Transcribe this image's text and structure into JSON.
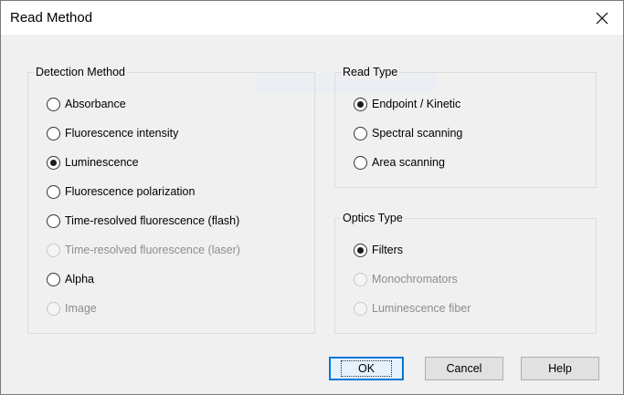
{
  "window": {
    "title": "Read Method",
    "close_icon": "close-icon"
  },
  "detection_method": {
    "label": "Detection Method",
    "options": [
      {
        "label": "Absorbance",
        "checked": false,
        "enabled": true
      },
      {
        "label": "Fluorescence intensity",
        "checked": false,
        "enabled": true
      },
      {
        "label": "Luminescence",
        "checked": true,
        "enabled": true
      },
      {
        "label": "Fluorescence polarization",
        "checked": false,
        "enabled": true
      },
      {
        "label": "Time-resolved fluorescence (flash)",
        "checked": false,
        "enabled": true
      },
      {
        "label": "Time-resolved fluorescence (laser)",
        "checked": false,
        "enabled": false
      },
      {
        "label": "Alpha",
        "checked": false,
        "enabled": true
      },
      {
        "label": "Image",
        "checked": false,
        "enabled": false
      }
    ]
  },
  "read_type": {
    "label": "Read Type",
    "options": [
      {
        "label": "Endpoint / Kinetic",
        "checked": true,
        "enabled": true
      },
      {
        "label": "Spectral scanning",
        "checked": false,
        "enabled": true
      },
      {
        "label": "Area scanning",
        "checked": false,
        "enabled": true
      }
    ]
  },
  "optics_type": {
    "label": "Optics Type",
    "options": [
      {
        "label": "Filters",
        "checked": true,
        "enabled": true
      },
      {
        "label": "Monochromators",
        "checked": false,
        "enabled": false
      },
      {
        "label": "Luminescence fiber",
        "checked": false,
        "enabled": false
      }
    ]
  },
  "buttons": {
    "ok": "OK",
    "cancel": "Cancel",
    "help": "Help"
  },
  "colors": {
    "accent": "#0078d7",
    "dialog_bg": "#f0f0f0",
    "disabled_text": "#8d8d8d"
  }
}
